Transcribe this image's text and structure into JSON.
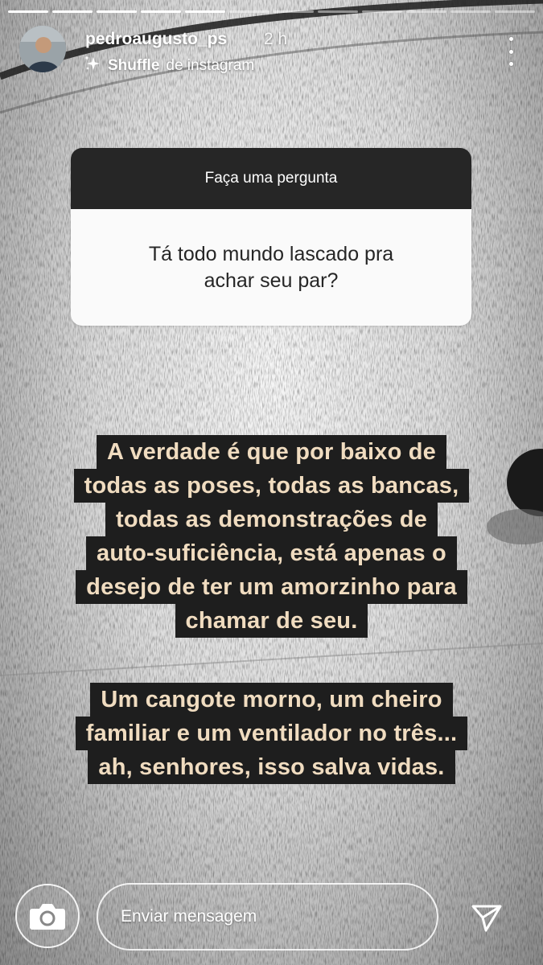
{
  "story": {
    "username": "pedroaugusto_ps",
    "time_ago": "2 h",
    "app_name": "Shuffle",
    "app_suffix": "de instagram",
    "progress": {
      "total_segments": 12,
      "completed_segments": 5
    }
  },
  "question_sticker": {
    "header": "Faça uma pergunta",
    "question_lines": [
      "Tá todo mundo lascado pra",
      "achar seu par?"
    ]
  },
  "captions": {
    "block1": [
      "A verdade é que por baixo de",
      "todas as poses, todas as bancas,",
      "todas as demonstrações de",
      "auto-suficiência, está apenas o",
      "desejo de ter um amorzinho para",
      "chamar de seu."
    ],
    "block2": [
      "Um cangote morno, um cheiro",
      "familiar e um ventilador no três...",
      "ah, senhores, isso salva vidas."
    ]
  },
  "footer": {
    "message_placeholder": "Enviar mensagem"
  },
  "icons": {
    "camera": "camera-icon",
    "send": "send-icon",
    "more": "more-vertical-icon",
    "sparkle": "sparkle-icon"
  },
  "colors": {
    "caption_bg": "#1e1e1e",
    "caption_text": "#f0dcc0",
    "sticker_header": "#262626",
    "sticker_body": "#fafafa"
  }
}
